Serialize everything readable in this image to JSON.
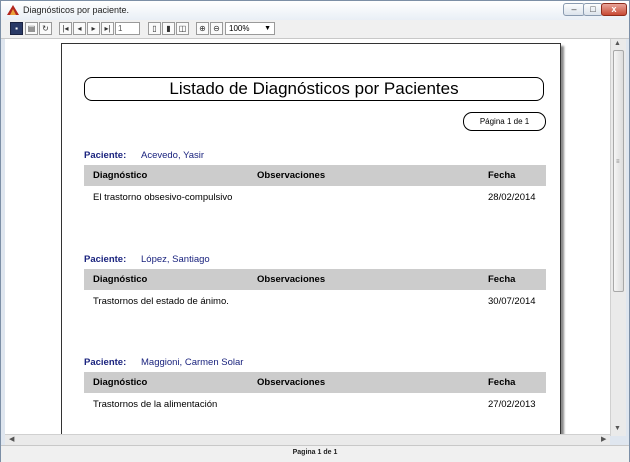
{
  "window": {
    "title": "Diagnósticos por paciente.",
    "min_glyph": "‒",
    "max_glyph": "□",
    "close_glyph": "x"
  },
  "toolbar": {
    "page_value": "1",
    "zoom_value": "100%"
  },
  "report": {
    "title": "Listado de Diagnósticos por Pacientes",
    "page_counter": "Página 1 de  1",
    "patient_label": "Paciente:",
    "headers": {
      "diagnostico": "Diagnóstico",
      "observaciones": "Observaciones",
      "fecha": "Fecha"
    },
    "patients": [
      {
        "name": "Acevedo, Yasir",
        "diagnostico": "El trastorno obsesivo-compulsivo",
        "observaciones": "",
        "fecha": "28/02/2014"
      },
      {
        "name": "López, Santiago",
        "diagnostico": "Trastornos del estado de ánimo.",
        "observaciones": "",
        "fecha": "30/07/2014"
      },
      {
        "name": "Maggioni, Carmen Solar",
        "diagnostico": "Trastornos de la alimentación",
        "observaciones": "",
        "fecha": "27/02/2013"
      }
    ]
  },
  "status": {
    "page_text": "Pagina 1 de 1"
  },
  "colors": {
    "patient_text": "#1a237e",
    "header_bg": "#cccccc",
    "close_button": "#c74a35"
  }
}
